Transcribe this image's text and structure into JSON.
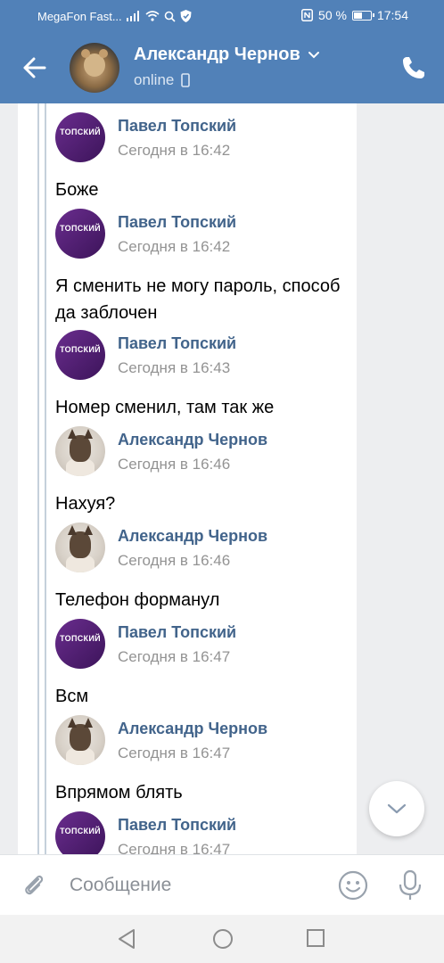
{
  "status_bar": {
    "carrier": "MegaFon Fast...",
    "battery_percent": "50 %",
    "battery_level": 0.5,
    "time": "17:54"
  },
  "header": {
    "contact_name": "Александр Чернов",
    "status": "online"
  },
  "messages": [
    {
      "author": "Павел Топский",
      "time": "Сегодня в 16:42",
      "text": "Боже",
      "avatar": "topsky-logo"
    },
    {
      "author": "Павел Топский",
      "time": "Сегодня в 16:42",
      "text": "Я сменить не могу пароль, способ да заблочен",
      "avatar": "topsky-logo"
    },
    {
      "author": "Павел Топский",
      "time": "Сегодня в 16:43",
      "text": "Номер сменил, там так же",
      "avatar": "topsky-logo"
    },
    {
      "author": "Александр Чернов",
      "time": "Сегодня в 16:46",
      "text": "Нахуя?",
      "avatar": "cat-photo"
    },
    {
      "author": "Александр Чернов",
      "time": "Сегодня в 16:46",
      "text": "Телефон форманул",
      "avatar": "cat-photo"
    },
    {
      "author": "Павел Топский",
      "time": "Сегодня в 16:47",
      "text": "Всм",
      "avatar": "topsky-logo"
    },
    {
      "author": "Александр Чернов",
      "time": "Сегодня в 16:47",
      "text": "Впрямом блять",
      "avatar": "cat-photo"
    },
    {
      "author": "Павел Топский",
      "time": "Сегодня в 16:47",
      "text": "",
      "avatar": "topsky-logo"
    }
  ],
  "avatar_logo_text": "ТОПСКИЙ",
  "composer": {
    "placeholder": "Сообщение"
  },
  "icons": {
    "back": "arrow-left-icon",
    "call": "phone-icon",
    "attach": "paperclip-icon",
    "emoji": "smiley-icon",
    "mic": "microphone-icon",
    "scroll_down": "chevron-down-icon"
  },
  "colors": {
    "header": "#5181b8",
    "author_name": "#42648b",
    "timestamp": "#939393"
  }
}
